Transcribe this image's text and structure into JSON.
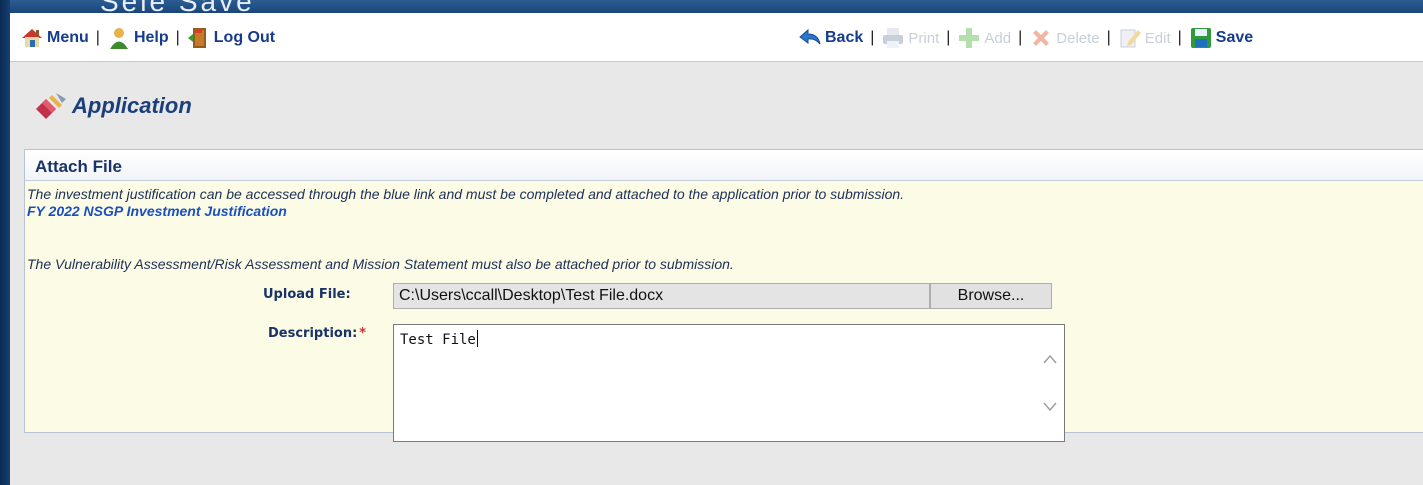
{
  "slide": {
    "top_fragment": "Sele Save"
  },
  "toolbar": {
    "menu_label": "Menu",
    "help_label": "Help",
    "logout_label": "Log Out",
    "back_label": "Back",
    "print_label": "Print",
    "add_label": "Add",
    "delete_label": "Delete",
    "edit_label": "Edit",
    "save_label": "Save",
    "separator": "|"
  },
  "page": {
    "title": "Application"
  },
  "panel": {
    "title": "Attach File",
    "instruction": "The investment justification can be accessed through the blue link and must be completed and attached to the application prior to submission.",
    "link_text": "FY 2022 NSGP Investment Justification",
    "notice": "The Vulnerability Assessment/Risk Assessment and Mission Statement must also be attached prior to submission."
  },
  "form": {
    "upload_label": "Upload File:",
    "upload_value": "C:\\Users\\ccall\\Desktop\\Test File.docx",
    "browse_label": "Browse...",
    "description_label": "Description:",
    "required_marker": "*",
    "description_value": "Test File"
  },
  "colors": {
    "link": "#1a4fbf",
    "label": "#1a3366",
    "panel_bg": "#fbfbe6",
    "required": "#d12b2b"
  }
}
